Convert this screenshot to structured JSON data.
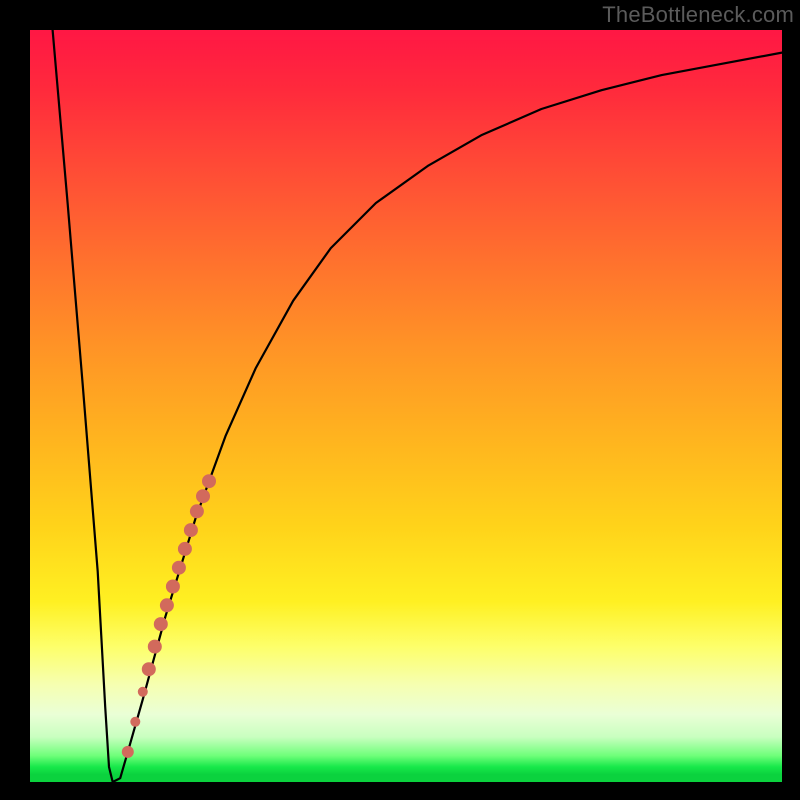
{
  "watermark": "TheBottleneck.com",
  "chart_data": {
    "type": "line",
    "title": "",
    "xlabel": "",
    "ylabel": "",
    "xlim": [
      0,
      100
    ],
    "ylim": [
      0,
      100
    ],
    "grid": false,
    "legend": false,
    "series": [
      {
        "name": "bottleneck-curve",
        "x": [
          3,
          5,
          7,
          9,
          10,
          10.5,
          11,
          12,
          13,
          15,
          18,
          22,
          26,
          30,
          35,
          40,
          46,
          53,
          60,
          68,
          76,
          84,
          92,
          100
        ],
        "y": [
          100,
          77,
          53,
          28,
          10,
          2,
          0,
          0.5,
          4,
          11,
          22,
          35,
          46,
          55,
          64,
          71,
          77,
          82,
          86,
          89.5,
          92,
          94,
          95.5,
          97
        ]
      }
    ],
    "markers": {
      "name": "highlight-dots",
      "color": "#d26a5c",
      "points": [
        {
          "x": 13.0,
          "y": 4.0,
          "r": 6
        },
        {
          "x": 14.0,
          "y": 8.0,
          "r": 5
        },
        {
          "x": 15.0,
          "y": 12.0,
          "r": 5
        },
        {
          "x": 15.8,
          "y": 15.0,
          "r": 7
        },
        {
          "x": 16.6,
          "y": 18.0,
          "r": 7
        },
        {
          "x": 17.4,
          "y": 21.0,
          "r": 7
        },
        {
          "x": 18.2,
          "y": 23.5,
          "r": 7
        },
        {
          "x": 19.0,
          "y": 26.0,
          "r": 7
        },
        {
          "x": 19.8,
          "y": 28.5,
          "r": 7
        },
        {
          "x": 20.6,
          "y": 31.0,
          "r": 7
        },
        {
          "x": 21.4,
          "y": 33.5,
          "r": 7
        },
        {
          "x": 22.2,
          "y": 36.0,
          "r": 7
        },
        {
          "x": 23.0,
          "y": 38.0,
          "r": 7
        },
        {
          "x": 23.8,
          "y": 40.0,
          "r": 7
        }
      ]
    },
    "background_gradient_stops": [
      {
        "pos": 0,
        "color": "#ff1744"
      },
      {
        "pos": 30,
        "color": "#ff6f2e"
      },
      {
        "pos": 66,
        "color": "#ffd31a"
      },
      {
        "pos": 82,
        "color": "#fdff6a"
      },
      {
        "pos": 94,
        "color": "#c9ffc0"
      },
      {
        "pos": 100,
        "color": "#0bd23e"
      }
    ]
  }
}
